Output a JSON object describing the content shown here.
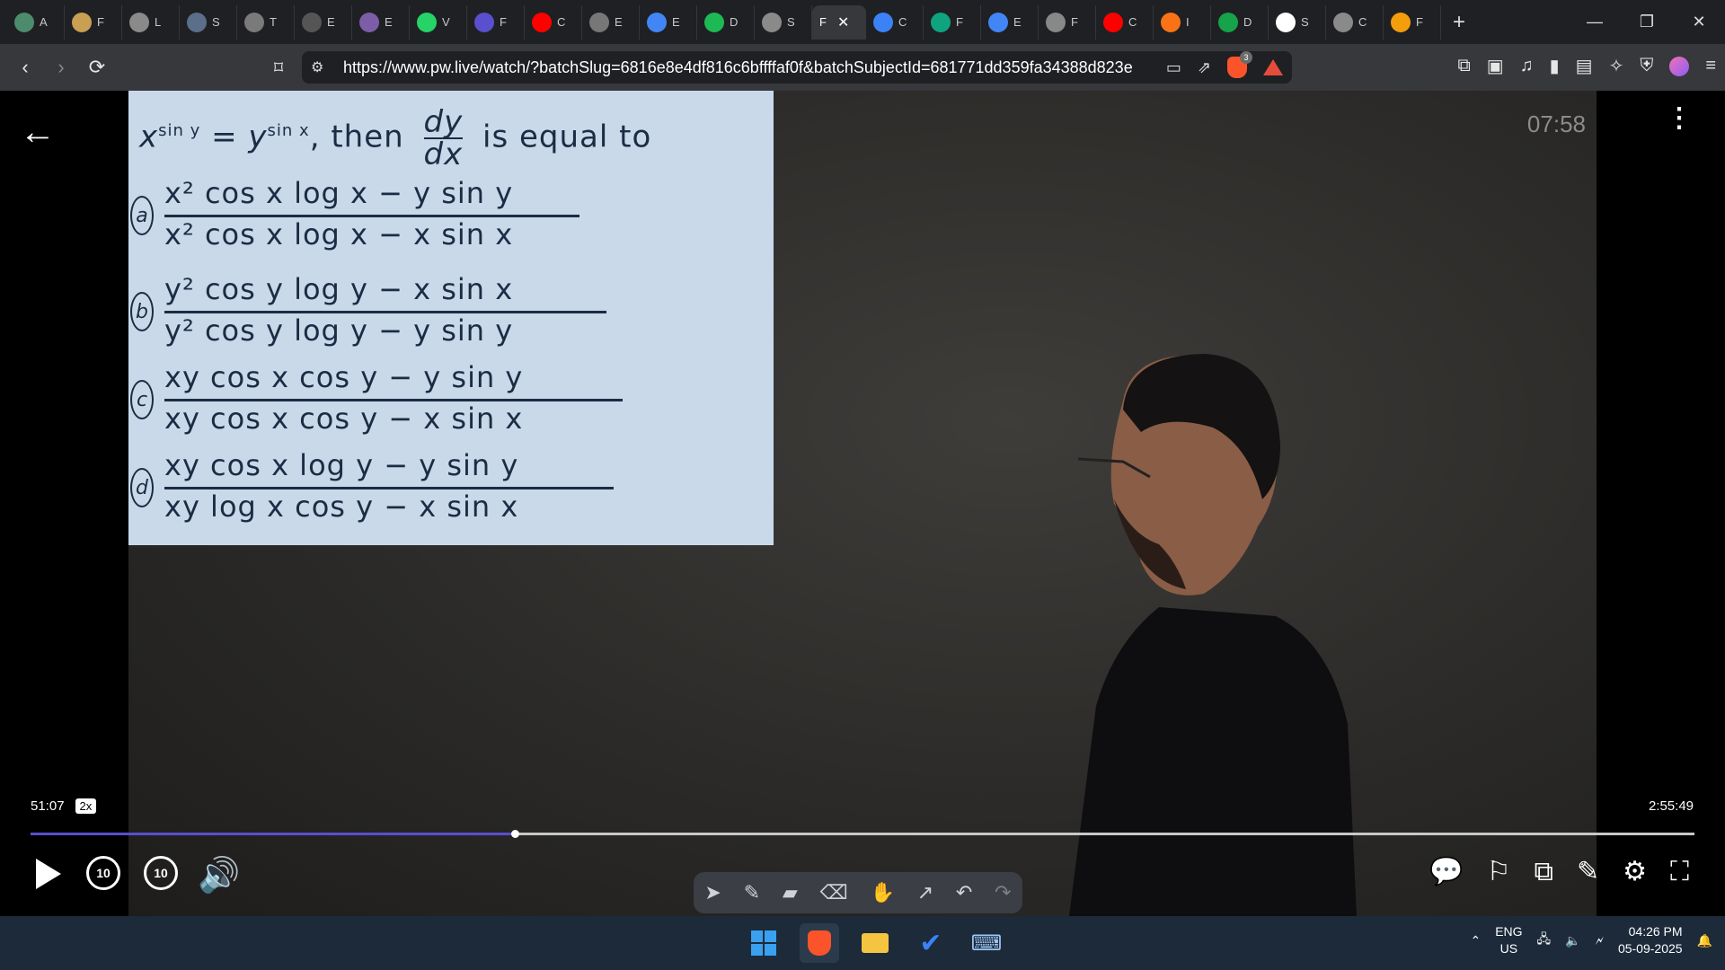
{
  "tabs": [
    {
      "letter": "A",
      "color": "#4c8c6c"
    },
    {
      "letter": "F",
      "color": "#c8a052"
    },
    {
      "letter": "L",
      "color": "#8a8a8a"
    },
    {
      "letter": "S",
      "color": "#5b6e8a"
    },
    {
      "letter": "T",
      "color": "#7a7a7a"
    },
    {
      "letter": "E",
      "color": "#555"
    },
    {
      "letter": "E",
      "color": "#7b5ea7"
    },
    {
      "letter": "V",
      "color": "#25d366"
    },
    {
      "letter": "F",
      "color": "#5a4fcf"
    },
    {
      "letter": "C",
      "color": "#ff0000"
    },
    {
      "letter": "E",
      "color": "#777"
    },
    {
      "letter": "E",
      "color": "#4285f4"
    },
    {
      "letter": "D",
      "color": "#1db954"
    },
    {
      "letter": "S",
      "color": "#8a8a8a"
    }
  ],
  "active_tab": {
    "letter": "F",
    "close": "✕"
  },
  "tabs_after": [
    {
      "letter": "C",
      "color": "#3b82f6"
    },
    {
      "letter": "F",
      "color": "#10a37f"
    },
    {
      "letter": "E",
      "color": "#4285f4"
    },
    {
      "letter": "F",
      "color": "#888"
    },
    {
      "letter": "C",
      "color": "#ff0000"
    },
    {
      "letter": "I",
      "color": "#f97316"
    },
    {
      "letter": "D",
      "color": "#16a34a"
    },
    {
      "letter": "S",
      "color": "#fff"
    },
    {
      "letter": "C",
      "color": "#8a8a8a"
    },
    {
      "letter": "F",
      "color": "#f59e0b"
    }
  ],
  "toolbar": {
    "url": "https://www.pw.live/watch/?batchSlug=6816e8e4df816c6bffffaf0f&batchSubjectId=681771dd359fa34388d823e...",
    "brave_badge": "3"
  },
  "video": {
    "timer": "07:58",
    "question": {
      "lhs": "x",
      "lhs_sup": "sin y",
      "eq": "=",
      "rhs": "y",
      "rhs_sup": "sin x",
      "then": ", then",
      "frac_top": "dy",
      "frac_bottom": "dx",
      "tail": "is equal to"
    },
    "options": [
      {
        "label": "a",
        "num": "x² cos x log x − y sin y",
        "den": "x² cos x log x − x sin x"
      },
      {
        "label": "b",
        "num": "y² cos y log y − x sin x",
        "den": "y² cos y log y − y sin y"
      },
      {
        "label": "c",
        "num": "xy cos x cos y − y sin y",
        "den": "xy cos x cos y − x sin x"
      },
      {
        "label": "d",
        "num": "xy cos x log y − y sin y",
        "den": "xy log x cos y − x sin x"
      }
    ]
  },
  "player": {
    "current_time": "51:07",
    "speed": "2x",
    "duration": "2:55:49",
    "progress_fraction": 0.291,
    "skip_back": "10",
    "skip_forward": "10"
  },
  "taskbar": {
    "lang_top": "ENG",
    "lang_bottom": "US",
    "time": "04:26 PM",
    "date": "05-09-2025"
  }
}
